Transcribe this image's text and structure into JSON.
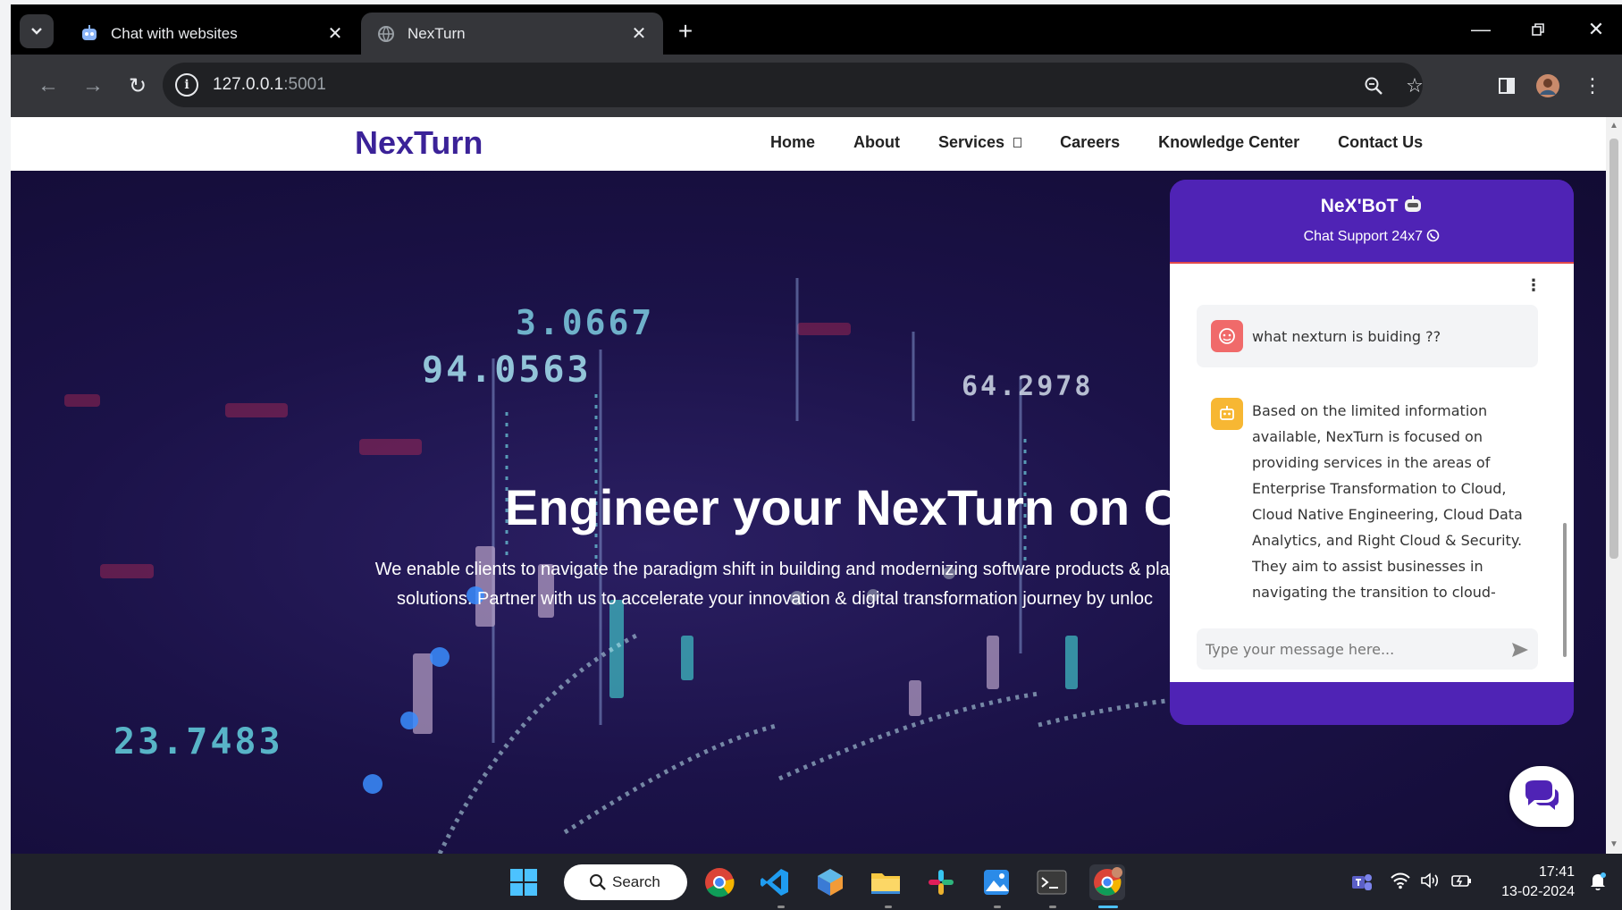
{
  "browser": {
    "tabs": [
      {
        "title": "Chat with websites",
        "active": false
      },
      {
        "title": "NexTurn",
        "active": true
      }
    ],
    "url_host": "127.0.0.1",
    "url_port": ":5001"
  },
  "site": {
    "logo": "NexTurn",
    "nav": [
      "Home",
      "About",
      "Services",
      "Careers",
      "Knowledge Center",
      "Contact Us"
    ],
    "hero": {
      "title": "Engineer your NexTurn on Cl",
      "subtitle_line1": "We enable clients to navigate the paradigm shift in building and modernizing software products & plat",
      "subtitle_line2": "solutions. Partner with us to accelerate your innovation & digital transformation journey by unloc",
      "background_numbers": [
        "3.0667",
        "94.0563",
        "64.2978",
        "23.7483"
      ]
    }
  },
  "chatbot": {
    "title": "NeX'BoT",
    "subtitle": "Chat Support 24x7",
    "user_message": "what nexturn is buiding ??",
    "bot_message": "Based on the limited information available, NexTurn is focused on providing services in the areas of Enterprise Transformation to Cloud, Cloud Native Engineering, Cloud Data Analytics, and Right Cloud & Security. They aim to assist businesses in navigating the transition to cloud-based solutions and leveraging",
    "input_placeholder": "Type your message here...",
    "accent_color": "#4f23b5"
  },
  "taskbar": {
    "search_label": "Search",
    "time": "17:41",
    "date": "13-02-2024"
  }
}
